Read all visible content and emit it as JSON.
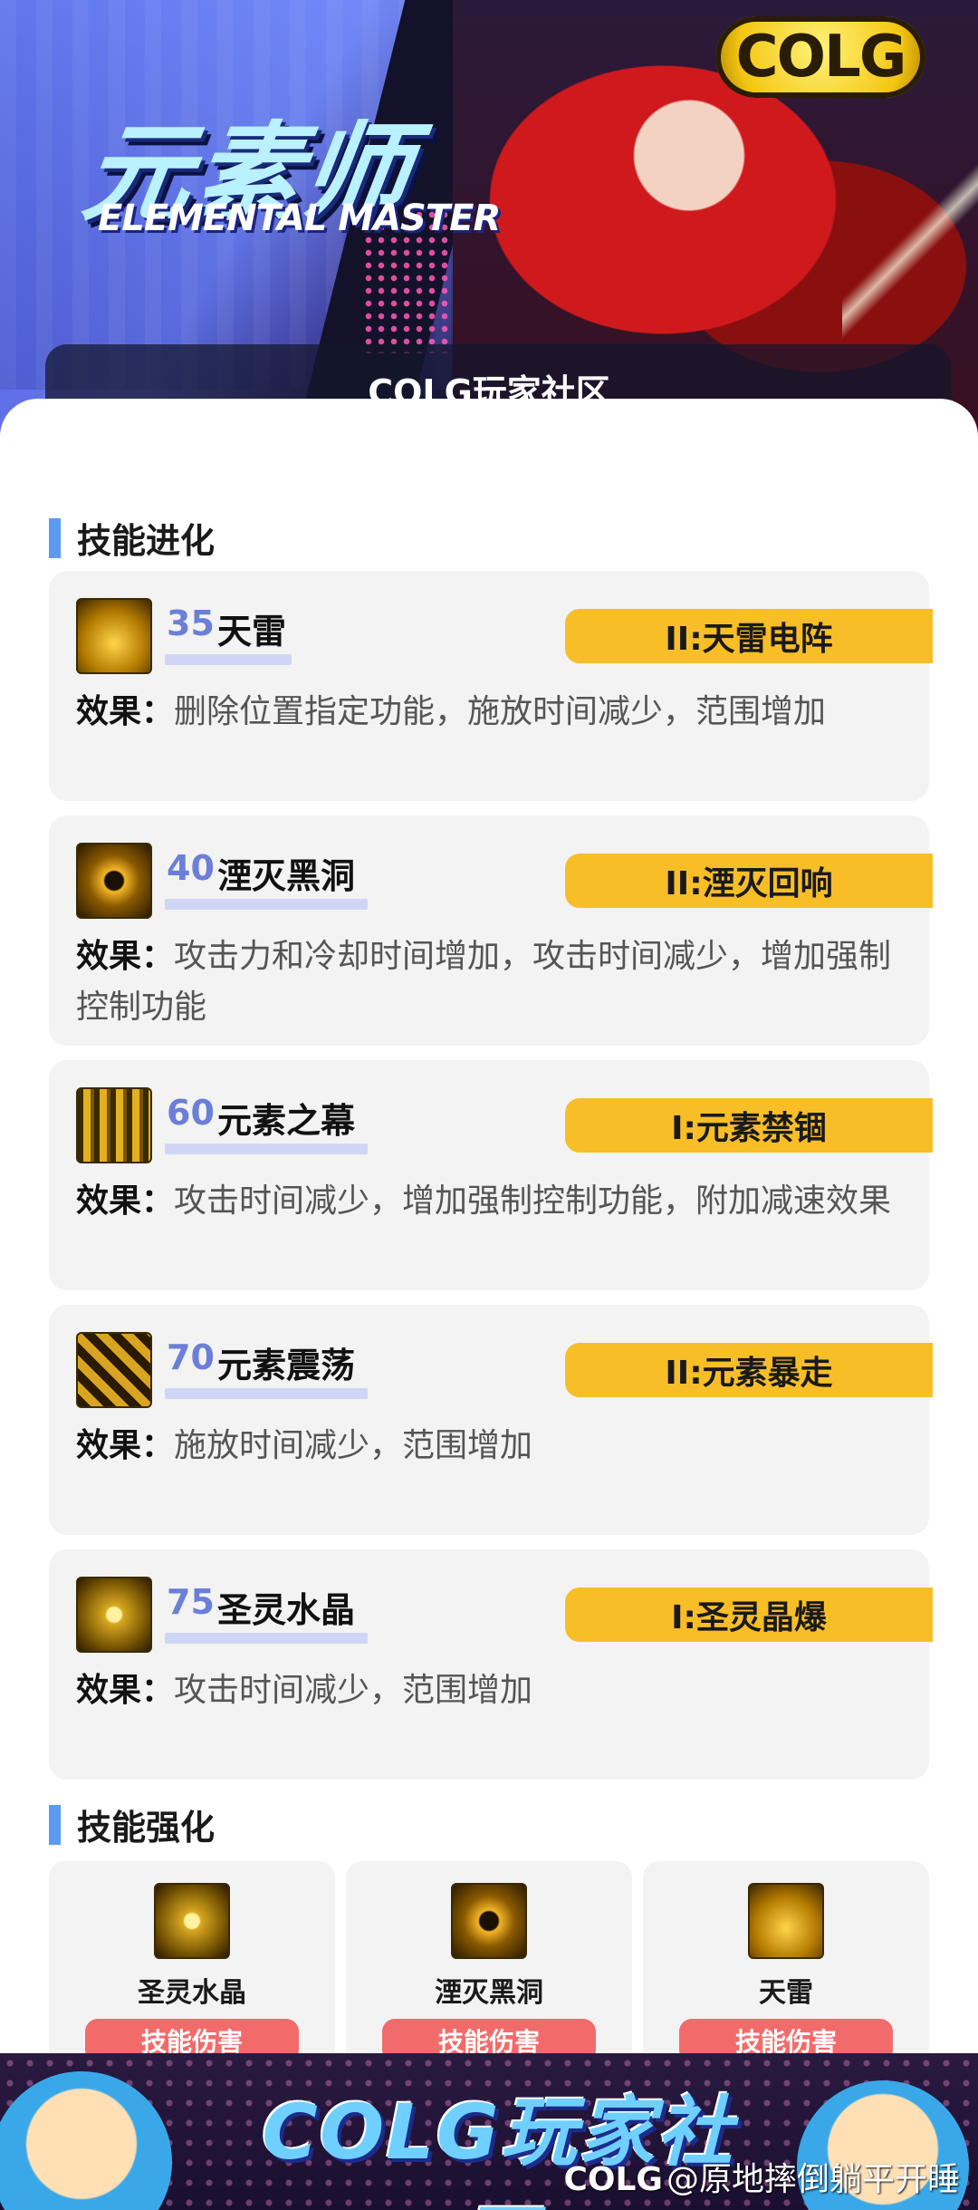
{
  "header": {
    "title_cn": "元素师",
    "title_en": "ELEMENTAL MASTER",
    "brand_logo": "COLG",
    "community_label": "COLG玩家社区"
  },
  "sections": {
    "evolution_title": "技能进化",
    "enhancement_title": "技能强化"
  },
  "effect_label": "效果：",
  "skills": [
    {
      "level": "35",
      "name": "天雷",
      "evolution": "II:天雷电阵",
      "effect": "删除位置指定功能，施放时间减少，范围增加",
      "icon": "thunder-icon"
    },
    {
      "level": "40",
      "name": "湮灭黑洞",
      "evolution": "II:湮灭回响",
      "effect": "攻击力和冷却时间增加，攻击时间减少，增加强制控制功能",
      "icon": "black-hole-icon"
    },
    {
      "level": "60",
      "name": "元素之幕",
      "evolution": "I:元素禁锢",
      "effect": "攻击时间减少，增加强制控制功能，附加减速效果",
      "icon": "element-curtain-icon"
    },
    {
      "level": "70",
      "name": "元素震荡",
      "evolution": "II:元素暴走",
      "effect": "施放时间减少，范围增加",
      "icon": "element-quake-icon"
    },
    {
      "level": "75",
      "name": "圣灵水晶",
      "evolution": "I:圣灵晶爆",
      "effect": "攻击时间减少，范围增加",
      "icon": "holy-crystal-icon"
    }
  ],
  "enhancements": [
    {
      "name": "圣灵水晶",
      "badge": "技能伤害",
      "icon": "holy-crystal-icon"
    },
    {
      "name": "湮灭黑洞",
      "badge": "技能伤害",
      "icon": "black-hole-icon"
    },
    {
      "name": "天雷",
      "badge": "技能伤害",
      "icon": "thunder-icon"
    }
  ],
  "footer": {
    "slogan": "COLG玩家社区",
    "watermark_logo": "COLG",
    "watermark_text": "@原地摔倒躺平开睡"
  },
  "colors": {
    "accent_blue": "#5b9bf0",
    "level_blue": "#6b7fd9",
    "evo_tag_yellow": "#f8be28",
    "badge_red": "#f26b6b",
    "card_bg": "#f3f3f3"
  }
}
